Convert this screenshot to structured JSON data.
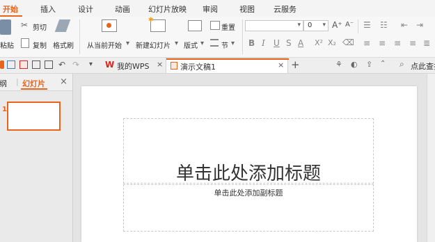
{
  "menu": {
    "tabs": [
      "开始",
      "插入",
      "设计",
      "动画",
      "幻灯片放映",
      "审阅",
      "视图",
      "云服务"
    ],
    "active_index": 0
  },
  "ribbon": {
    "paste": "粘贴",
    "cut": "剪切",
    "copy": "复制",
    "format_painter": "格式刷",
    "from_current": "从当前开始",
    "new_slide": "新建幻灯片",
    "layout": "版式",
    "reset": "重置",
    "section": "节",
    "font_size": "0",
    "format_buttons": [
      "B",
      "I",
      "U",
      "S",
      "A",
      "X²",
      "X₂"
    ]
  },
  "tabbar": {
    "wps_tab": "我的WPS",
    "doc_tab": "演示文稿1",
    "add_tab": "+",
    "search_placeholder": "点此查找命令"
  },
  "panel": {
    "outline_tab": "大纲",
    "slides_tab": "幻灯片",
    "close": "×",
    "slide_number": "1"
  },
  "slide": {
    "title_placeholder": "单击此处添加标题",
    "subtitle_placeholder": "单击此处添加副标题"
  },
  "colors": {
    "accent": "#e8641b",
    "wps_red": "#d9251d"
  }
}
